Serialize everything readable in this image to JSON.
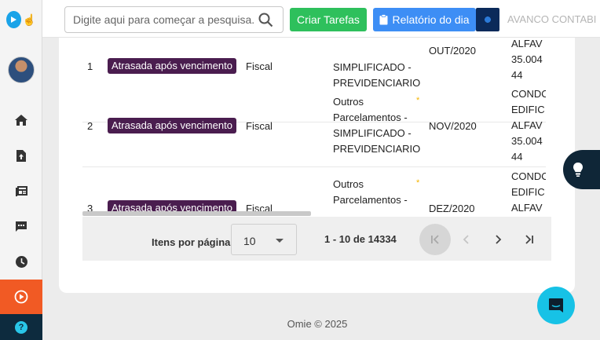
{
  "header": {
    "search_placeholder": "Digite aqui para começar a pesquisa...",
    "create_tasks_label": "Criar Tarefas",
    "daily_report_label": "Relatório do dia",
    "company_name": "AVANCO CONTABI"
  },
  "table": {
    "rows": [
      {
        "index": "1",
        "status": "Atrasada após vencimento",
        "type": "Fiscal",
        "description": [
          "SIMPLIFICADO -",
          "PREVIDENCIARIO"
        ],
        "period": "OUT/2020",
        "client": [
          "ALFAV",
          "35.004",
          "44"
        ]
      },
      {
        "index": "2",
        "status": "Atrasada após vencimento",
        "type": "Fiscal",
        "description": [
          "Outros",
          "Parcelamentos -",
          "SIMPLIFICADO -",
          "PREVIDENCIARIO"
        ],
        "star": "*",
        "period": "NOV/2020",
        "client": [
          "CONDO",
          "EDIFIC",
          "ALFAV",
          "35.004",
          "44"
        ]
      },
      {
        "index": "3",
        "status": "Atrasada após vencimento",
        "type": "Fiscal",
        "description": [
          "Outros",
          "Parcelamentos -"
        ],
        "star": "*",
        "period": "DEZ/2020",
        "client": [
          "CONDO",
          "EDIFIC",
          "ALFAV"
        ]
      }
    ]
  },
  "pagination": {
    "items_per_page_label": "Itens por página",
    "items_per_page_value": "10",
    "range_text": "1 - 10 de 14334"
  },
  "footer": {
    "text": "Omie © 2025"
  },
  "colors": {
    "accent_orange": "#f15a24",
    "badge_purple": "#4a1d4f",
    "btn_green": "#2ec05c",
    "btn_blue": "#3d8ef5",
    "chat_cyan": "#17c2e6"
  },
  "icons": {
    "sidebar": [
      "home-icon",
      "upload-file-icon",
      "news-icon",
      "chat-icon",
      "clock-icon",
      "play-icon",
      "help-icon"
    ]
  }
}
